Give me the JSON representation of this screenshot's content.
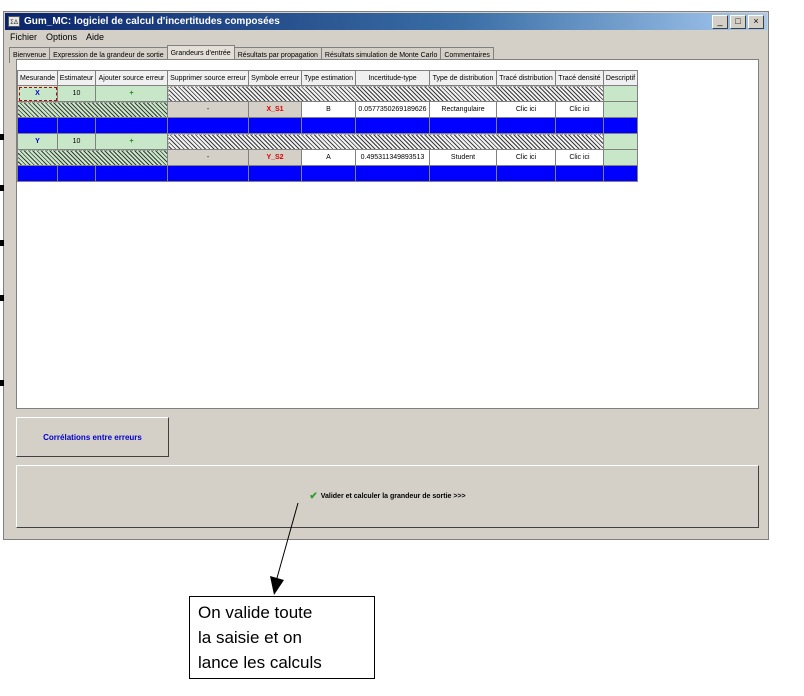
{
  "window": {
    "title": "Gum_MC: logiciel de calcul d'incertitudes composées",
    "icon_text": "ΣΔ",
    "controls": [
      "_",
      "□",
      "×"
    ]
  },
  "menu": [
    "Fichier",
    "Options",
    "Aide"
  ],
  "tabs": [
    {
      "label": "Bienvenue",
      "active": false
    },
    {
      "label": "Expression de la grandeur de sortie",
      "active": false
    },
    {
      "label": "Grandeurs d'entrée",
      "active": true
    },
    {
      "label": "Résultats par propagation",
      "active": false
    },
    {
      "label": "Résultats simulation de Monte Carlo",
      "active": false
    },
    {
      "label": "Commentaires",
      "active": false
    }
  ],
  "table": {
    "headers": [
      "Mesurande",
      "Estimateur",
      "Ajouter source erreur",
      "Supprimer source erreur",
      "Symbole erreur",
      "Type estimation",
      "Incertitude-type",
      "Type de distribution",
      "Tracé distribution",
      "Tracé densité",
      "Descriptif"
    ],
    "measurands": [
      {
        "name": "X",
        "estimator": "10",
        "add": "+",
        "remove": "-",
        "symbol": "X_S1",
        "type": "B",
        "uncertainty": "0.0577350269189626",
        "distribution": "Rectangulaire",
        "plot_distribution": "Clic ici",
        "plot_density": "Clic ici"
      },
      {
        "name": "Y",
        "estimator": "10",
        "add": "+",
        "remove": "-",
        "symbol": "Y_S2",
        "type": "A",
        "uncertainty": "0.495311349893513",
        "distribution": "Student",
        "plot_distribution": "Clic ici",
        "plot_density": "Clic ici"
      }
    ]
  },
  "buttons": {
    "correlations": "Corrélations entre erreurs",
    "validate": "Valider et calculer la grandeur de sortie >>>"
  },
  "callout": {
    "lines": [
      "On valide toute",
      "la saisie et on",
      "lance les calculs"
    ]
  },
  "colors": {
    "title_bar": "#0a246a",
    "row_separator": "#0000ff",
    "measurand_text": "#0000cc",
    "symbol_text": "#dd0000",
    "cell_green": "#c8e6c8"
  }
}
